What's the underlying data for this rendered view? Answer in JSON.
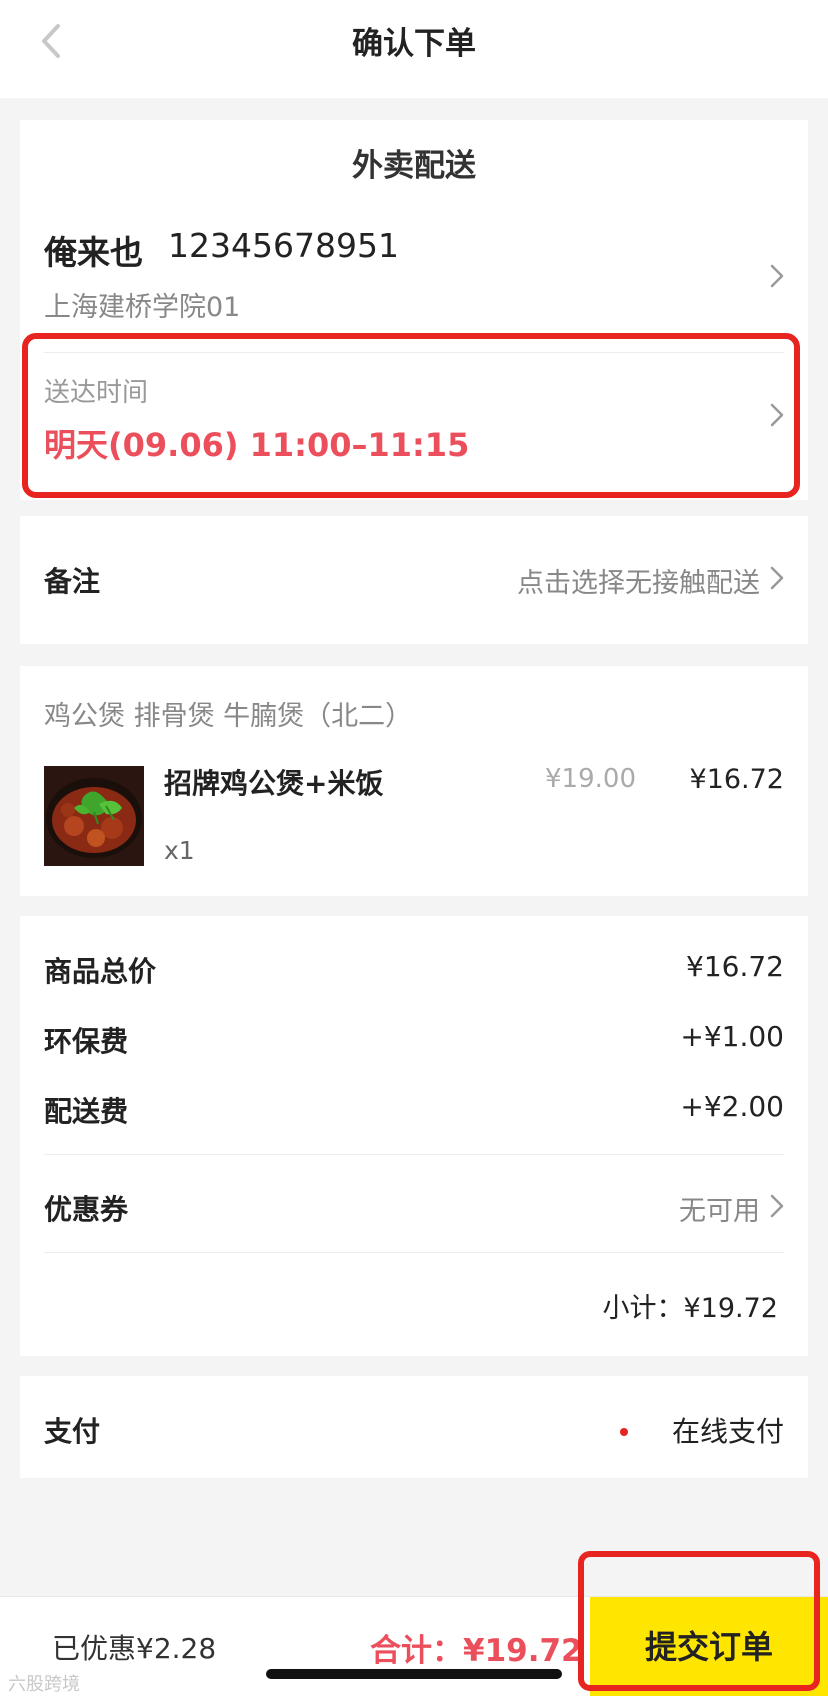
{
  "header": {
    "title": "确认下单"
  },
  "delivery": {
    "mode": "外卖配送",
    "contact_name": "俺来也",
    "contact_phone": "12345678951",
    "address": "上海建桥学院01",
    "time_label": "送达时间",
    "time_value": "明天(09.06) 11:00–11:15"
  },
  "remark": {
    "label": "备注",
    "value": "点击选择无接触配送"
  },
  "shop": {
    "name": "鸡公煲 排骨煲 牛腩煲（北二）",
    "items": [
      {
        "name": "招牌鸡公煲+米饭",
        "qty": "x1",
        "original_price": "¥19.00",
        "price": "¥16.72"
      }
    ]
  },
  "costs": {
    "goods_total_label": "商品总价",
    "goods_total_value": "¥16.72",
    "eco_fee_label": "环保费",
    "eco_fee_value": "+¥1.00",
    "delivery_fee_label": "配送费",
    "delivery_fee_value": "+¥2.00",
    "coupon_label": "优惠券",
    "coupon_value": "无可用",
    "subtotal": "小计：¥19.72"
  },
  "payment": {
    "label": "支付",
    "method": "在线支付"
  },
  "bottom_bar": {
    "saved": "已优惠¥2.28",
    "total": "合计：¥19.72",
    "submit": "提交订单"
  },
  "watermark": "六股跨境",
  "colors": {
    "accent_red": "#ec4f5c",
    "submit_yellow": "#ffe600",
    "highlight_red": "#e82420"
  },
  "icons": {
    "back": "chevron-left-icon",
    "row_arrow": "chevron-right-icon"
  }
}
